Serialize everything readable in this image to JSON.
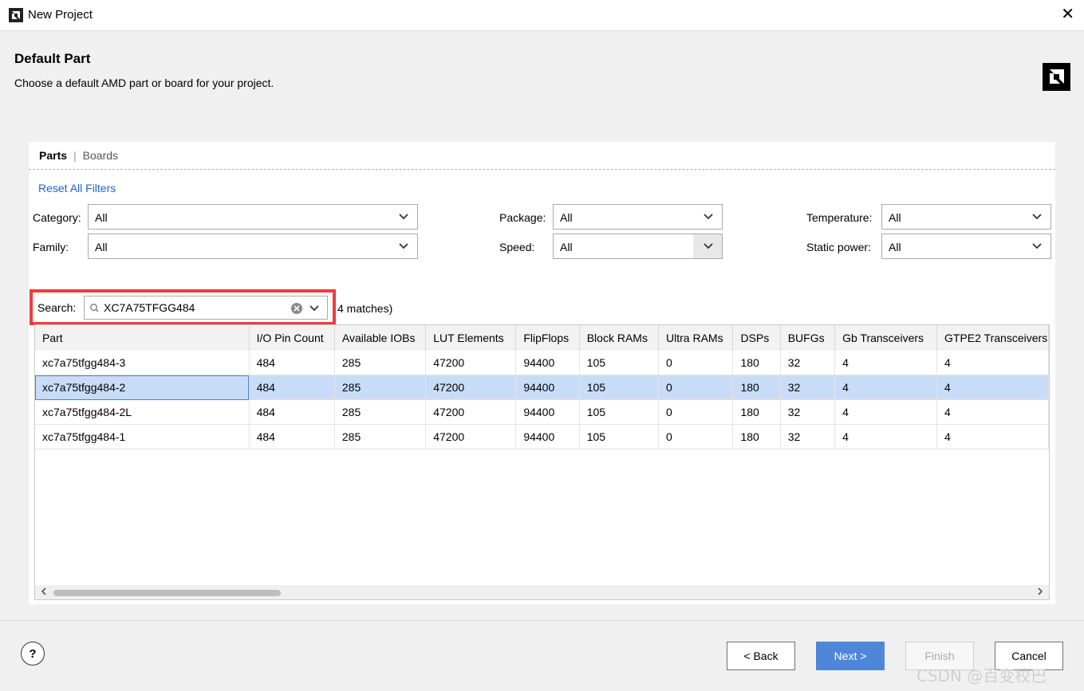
{
  "window": {
    "title": "New Project",
    "close_glyph": "✕"
  },
  "header": {
    "title": "Default Part",
    "subtitle": "Choose a default AMD part or board for your project."
  },
  "tabs": [
    {
      "label": "Parts",
      "active": true
    },
    {
      "label": "Boards",
      "active": false
    }
  ],
  "tab_separator": "|",
  "reset_filters": "Reset All Filters",
  "filters": {
    "category": {
      "label": "Category:",
      "value": "All"
    },
    "family": {
      "label": "Family:",
      "value": "All"
    },
    "package": {
      "label": "Package:",
      "value": "All"
    },
    "speed": {
      "label": "Speed:",
      "value": "All"
    },
    "temperature": {
      "label": "Temperature:",
      "value": "All"
    },
    "static_power": {
      "label": "Static power:",
      "value": "All"
    }
  },
  "search": {
    "label": "Search:",
    "value": "XC7A75TFGG484",
    "matches": "4 matches)"
  },
  "table": {
    "columns": [
      "Part",
      "I/O Pin Count",
      "Available IOBs",
      "LUT Elements",
      "FlipFlops",
      "Block RAMs",
      "Ultra RAMs",
      "DSPs",
      "BUFGs",
      "Gb Transceivers",
      "GTPE2 Transceivers"
    ],
    "selected_row": 1,
    "rows": [
      [
        "xc7a75tfgg484-3",
        "484",
        "285",
        "47200",
        "94400",
        "105",
        "0",
        "180",
        "32",
        "4",
        "4"
      ],
      [
        "xc7a75tfgg484-2",
        "484",
        "285",
        "47200",
        "94400",
        "105",
        "0",
        "180",
        "32",
        "4",
        "4"
      ],
      [
        "xc7a75tfgg484-2L",
        "484",
        "285",
        "47200",
        "94400",
        "105",
        "0",
        "180",
        "32",
        "4",
        "4"
      ],
      [
        "xc7a75tfgg484-1",
        "484",
        "285",
        "47200",
        "94400",
        "105",
        "0",
        "180",
        "32",
        "4",
        "4"
      ]
    ]
  },
  "footer": {
    "help": "?",
    "back": "< Back",
    "next": "Next >",
    "finish": "Finish",
    "cancel": "Cancel"
  },
  "watermark": "CSDN @百变校巴",
  "colors": {
    "accent": "#4f87d8",
    "link": "#1a62d8",
    "selection": "#c9dcf7",
    "highlight": "#f03c3c"
  }
}
